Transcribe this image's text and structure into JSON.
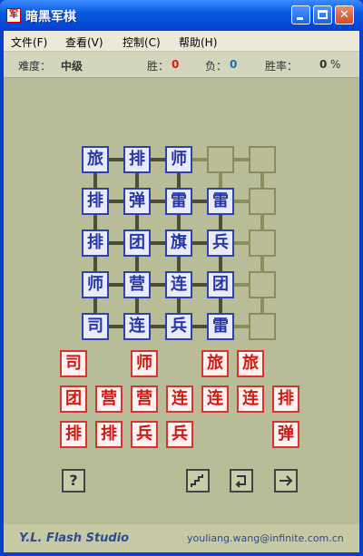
{
  "window": {
    "title": "暗黑军棋",
    "icon_glyph": "军"
  },
  "menu": [
    "文件(F)",
    "查看(V)",
    "控制(C)",
    "帮助(H)"
  ],
  "status": {
    "difficulty_label": "难度：",
    "difficulty_value": "中级",
    "win_label": "胜：",
    "win_value": "0",
    "lose_label": "负：",
    "lose_value": "0",
    "rate_label": "胜率：",
    "rate_value": "0",
    "rate_unit": "%"
  },
  "board": {
    "rows": [
      [
        "旅",
        "排",
        "师",
        "",
        ""
      ],
      [
        "排",
        "弹",
        "雷",
        "雷",
        ""
      ],
      [
        "排",
        "团",
        "旗",
        "兵",
        ""
      ],
      [
        "师",
        "营",
        "连",
        "团",
        ""
      ],
      [
        "司",
        "连",
        "兵",
        "雷",
        ""
      ]
    ]
  },
  "reserve": {
    "rows": [
      [
        "司",
        "",
        "师",
        "",
        "旅",
        "旅",
        ""
      ],
      [
        "团",
        "营",
        "营",
        "连",
        "连",
        "连",
        "排"
      ],
      [
        "排",
        "排",
        "兵",
        "兵",
        "",
        "",
        "弹"
      ]
    ]
  },
  "tools": {
    "help_glyph": "?",
    "step_glyph": "⌐",
    "undo_glyph": "↩",
    "next_glyph": "→"
  },
  "footer": {
    "studio": "Y.L. Flash Studio",
    "email": "youliang.wang@infinite.com.cn"
  },
  "colors": {
    "board_bg": "#b8bc97",
    "blue_piece": "#2837a7",
    "red_piece": "#cc1b12"
  }
}
